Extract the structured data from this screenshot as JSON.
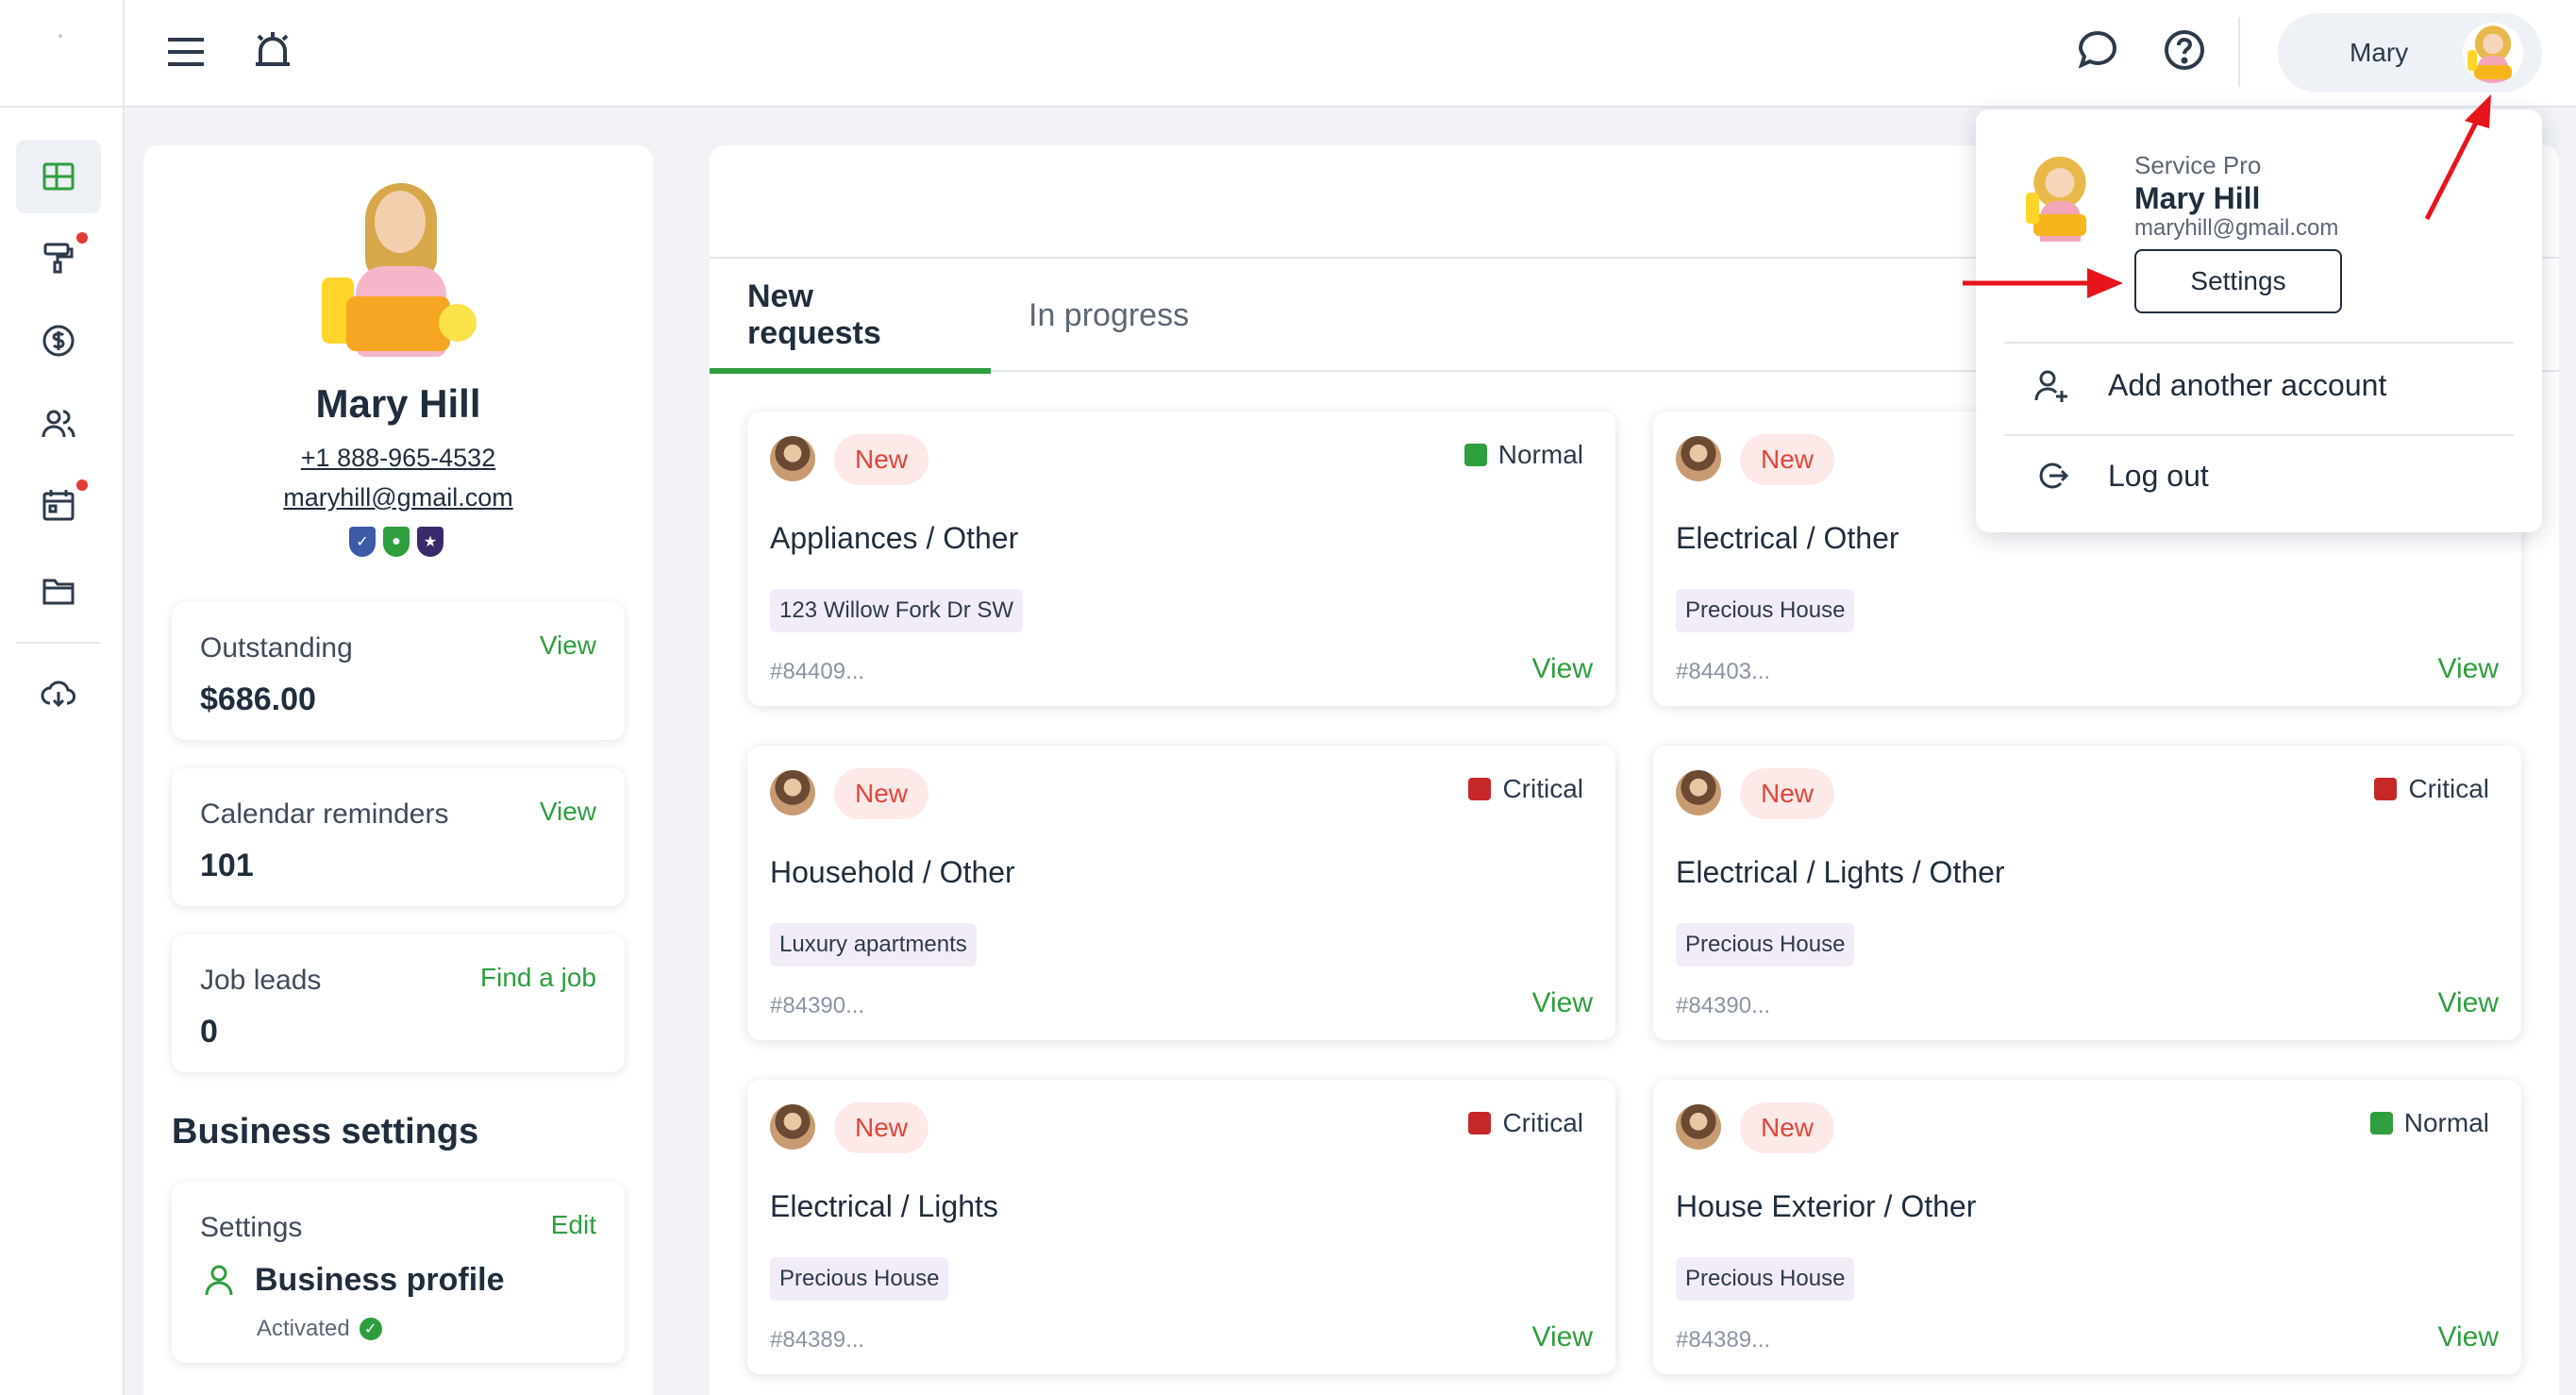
{
  "topbar": {
    "menu_icon": "hamburger-menu-icon",
    "alarm_icon": "alarm-bell-icon",
    "chat_icon": "chat-bubble-icon",
    "help_icon": "help-question-icon",
    "user_name": "Mary"
  },
  "sidebar": {
    "items": [
      {
        "icon": "dashboard-icon",
        "active": true
      },
      {
        "icon": "paint-roller-icon",
        "notify": true
      },
      {
        "icon": "dollar-icon"
      },
      {
        "icon": "users-icon"
      },
      {
        "icon": "calendar-icon",
        "notify": true
      },
      {
        "icon": "folder-icon"
      },
      {
        "icon": "cloud-download-icon"
      }
    ]
  },
  "profile": {
    "name": "Mary Hill",
    "phone": "+1 888-965-4532",
    "email": "maryhill@gmail.com",
    "badge_colors": [
      "#3c5aa6",
      "#2e9e3e",
      "#3b2a6b"
    ]
  },
  "stats": [
    {
      "label": "Outstanding",
      "link": "View",
      "value": "$686.00"
    },
    {
      "label": "Calendar reminders",
      "link": "View",
      "value": "101"
    },
    {
      "label": "Job leads",
      "link": "Find a job",
      "value": "0"
    }
  ],
  "business": {
    "section_title": "Business settings",
    "card_label": "Settings",
    "card_link": "Edit",
    "profile_title": "Business profile",
    "status": "Activated"
  },
  "tabs": [
    {
      "label": "New requests",
      "active": true
    },
    {
      "label": "In progress",
      "active": false
    }
  ],
  "requests": [
    {
      "status": "New",
      "priority": "Normal",
      "priority_color": "#2e9e3e",
      "category": "Appliances / Other",
      "tag": "123 Willow Fork Dr SW",
      "id": "#84409...",
      "action": "View"
    },
    {
      "status": "New",
      "priority": "",
      "priority_color": "",
      "category": "Electrical / Other",
      "tag": "Precious House",
      "id": "#84403...",
      "action": "View"
    },
    {
      "status": "New",
      "priority": "Critical",
      "priority_color": "#c62828",
      "category": "Household / Other",
      "tag": "Luxury apartments",
      "id": "#84390...",
      "action": "View"
    },
    {
      "status": "New",
      "priority": "Critical",
      "priority_color": "#c62828",
      "category": "Electrical / Lights / Other",
      "tag": "Precious House",
      "id": "#84390...",
      "action": "View"
    },
    {
      "status": "New",
      "priority": "Critical",
      "priority_color": "#c62828",
      "category": "Electrical / Lights",
      "tag": "Precious House",
      "id": "#84389...",
      "action": "View"
    },
    {
      "status": "New",
      "priority": "Normal",
      "priority_color": "#2e9e3e",
      "category": "House Exterior / Other",
      "tag": "Precious House",
      "id": "#84389...",
      "action": "View"
    }
  ],
  "dropdown": {
    "role": "Service Pro",
    "name": "Mary Hill",
    "email": "maryhill@gmail.com",
    "settings_label": "Settings",
    "add_account_label": "Add another account",
    "logout_label": "Log out"
  },
  "colors": {
    "accent_green": "#2e9e3e",
    "annotation_red": "#e8141c",
    "new_pill_bg": "#fde9e7",
    "new_pill_text": "#e0463b"
  }
}
